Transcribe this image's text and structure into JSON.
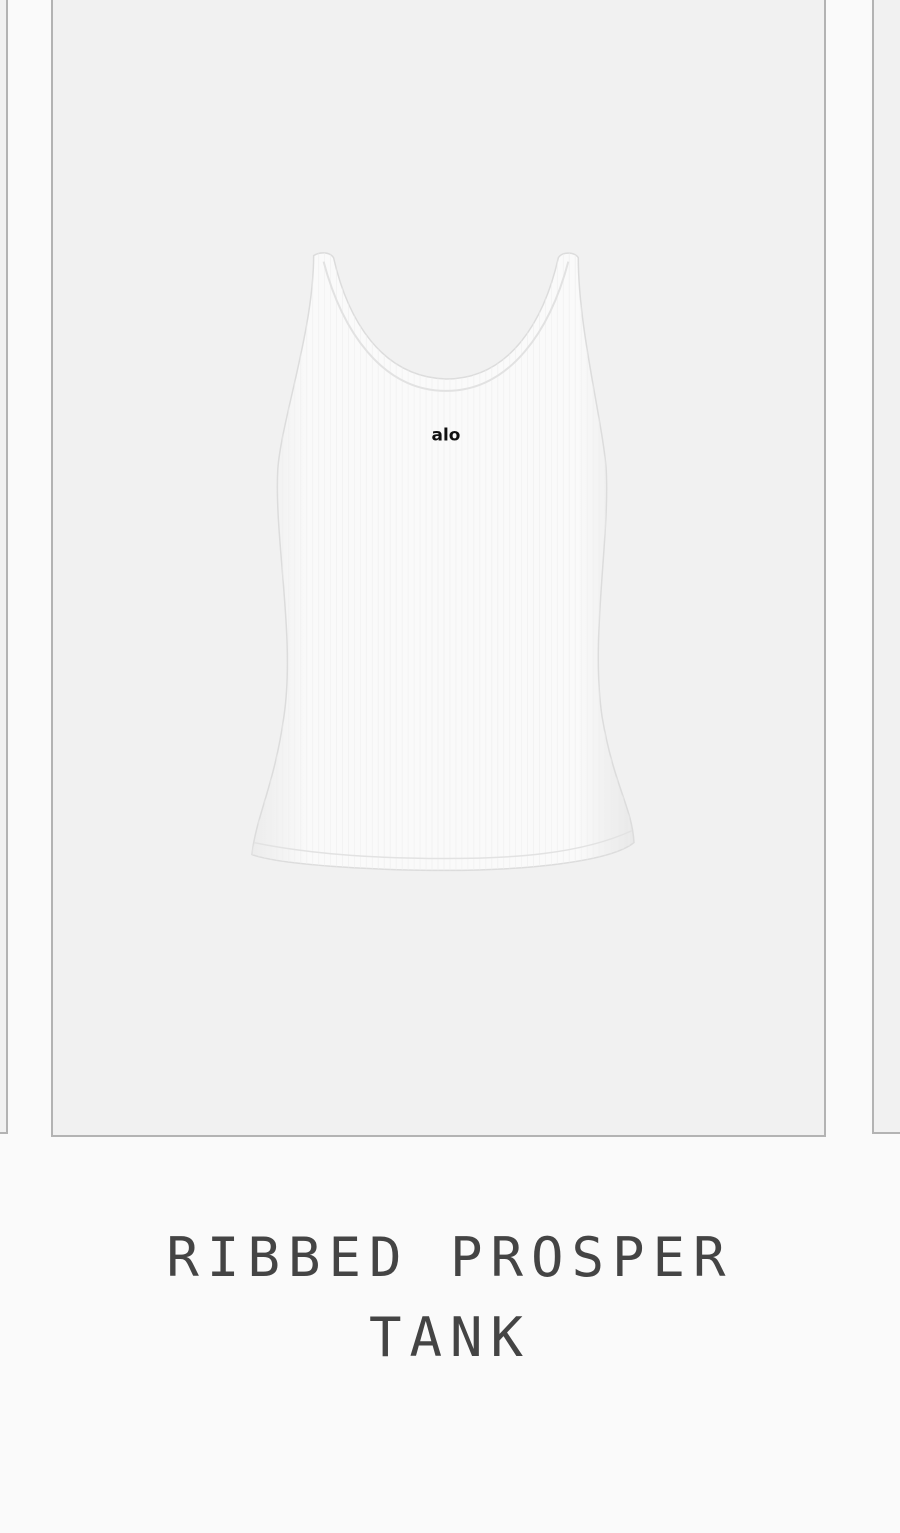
{
  "product": {
    "title_line1": "RIBBED PROSPER",
    "title_line2": "TANK",
    "logo_text": "alo",
    "garment_color": "#ffffff",
    "card_background": "#f1f1f1"
  },
  "carousel": {
    "prev_card": "partial",
    "next_card": "partial"
  }
}
